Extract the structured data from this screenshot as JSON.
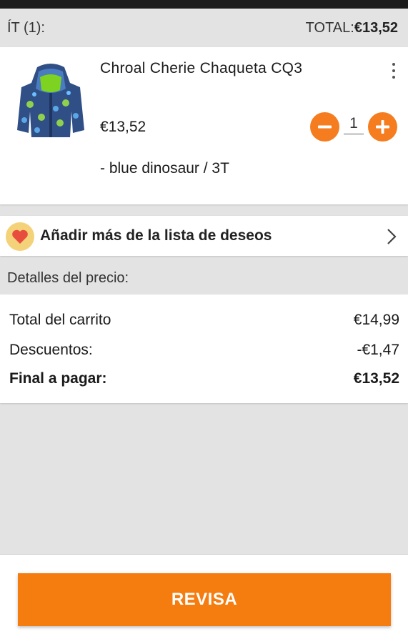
{
  "summary": {
    "items_label": "ÍT (1):",
    "total_label": "TOTAL:",
    "total_value": "€13,52"
  },
  "product": {
    "name": "Chroal Cherie Chaqueta CQ3",
    "price": "€13,52",
    "quantity": "1",
    "variant": "- blue dinosaur / 3T",
    "image_icon": "jacket-image",
    "more_icon": "more-vertical-icon"
  },
  "wishlist": {
    "label": "Añadir más de la lista de deseos",
    "icon": "heart-icon",
    "chevron": "chevron-right-icon"
  },
  "price_details": {
    "title": "Detalles del precio:",
    "lines": [
      {
        "label": "Total del carrito",
        "value": "€14,99"
      },
      {
        "label": "Descuentos:",
        "value": "-€1,47"
      },
      {
        "label": "Final a pagar:",
        "value": "€13,52"
      }
    ]
  },
  "checkout": {
    "button_label": "REVISA"
  },
  "colors": {
    "accent": "#f57c0f",
    "background": "#e3e3e3",
    "card": "#ffffff"
  }
}
